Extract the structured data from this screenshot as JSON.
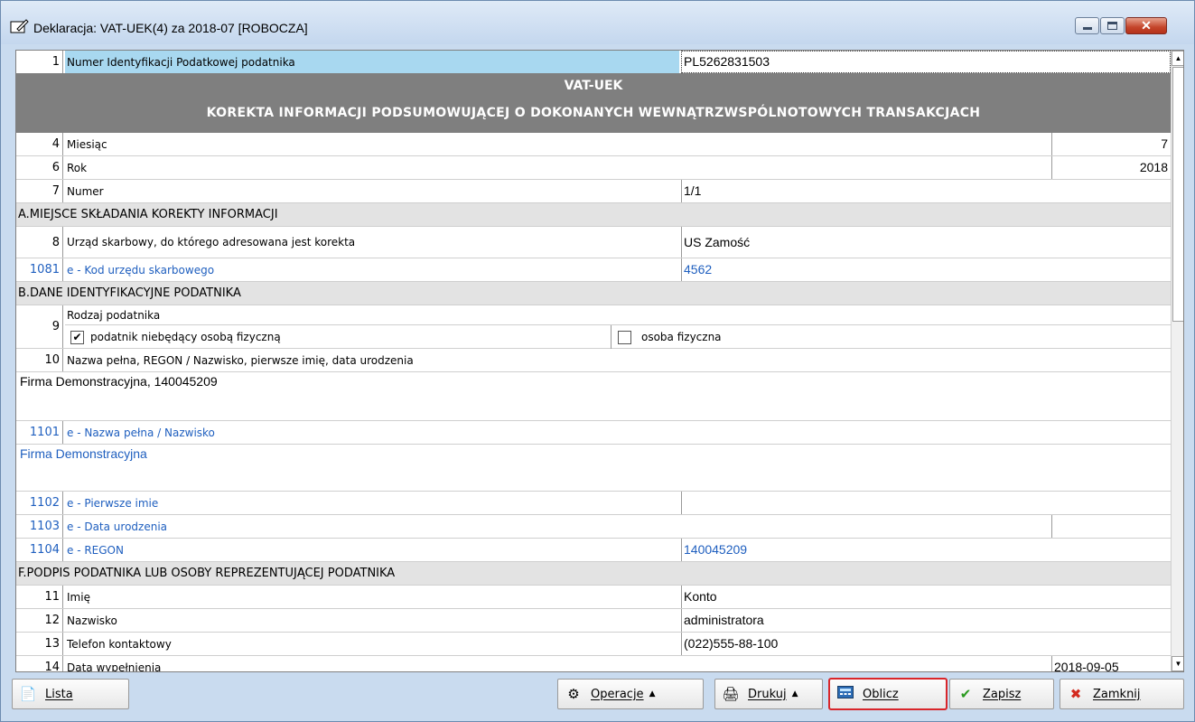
{
  "window": {
    "title": "Deklaracja: VAT-UEK(4) za 2018-07  [ROBOCZA]"
  },
  "form": {
    "row1": {
      "num": "1",
      "label": "Numer Identyfikacji Podatkowej podatnika",
      "value": "PL5262831503"
    },
    "header": {
      "line1": "VAT-UEK",
      "line2": "KOREKTA INFORMACJI PODSUMOWUJĄCEJ O DOKONANYCH WEWNĄTRZWSPÓLNOTOWYCH TRANSAKCJACH"
    },
    "row4": {
      "num": "4",
      "label": "Miesiąc",
      "value": "7"
    },
    "row6": {
      "num": "6",
      "label": "Rok",
      "value": "2018"
    },
    "row7": {
      "num": "7",
      "label": "Numer",
      "value": "1/1"
    },
    "sectionA": "A.MIEJSCE SKŁADANIA KOREKTY INFORMACJI",
    "row8": {
      "num": "8",
      "label": "Urząd skarbowy, do którego adresowana jest korekta",
      "value": "US Zamość"
    },
    "row1081": {
      "num": "1081",
      "label": "e - Kod urzędu skarbowego",
      "value": "4562"
    },
    "sectionB": "B.DANE IDENTYFIKACYJNE PODATNIKA",
    "row9": {
      "num": "9",
      "label": "Rodzaj podatnika",
      "option1": "podatnik niebędący osobą fizyczną",
      "option1_mark": "✔",
      "option2": "osoba fizyczna"
    },
    "row10": {
      "num": "10",
      "label": "Nazwa pełna, REGON / Nazwisko, pierwsze imię, data urodzenia",
      "value": "Firma Demonstracyjna, 140045209"
    },
    "row1101": {
      "num": "1101",
      "label": "e - Nazwa pełna / Nazwisko",
      "value": "Firma Demonstracyjna"
    },
    "row1102": {
      "num": "1102",
      "label": "e - Pierwsze imie",
      "value": ""
    },
    "row1103": {
      "num": "1103",
      "label": "e - Data urodzenia",
      "value": ""
    },
    "row1104": {
      "num": "1104",
      "label": "e - REGON",
      "value": "140045209"
    },
    "sectionF": "F.PODPIS PODATNIKA LUB OSOBY REPREZENTUJĄCEJ PODATNIKA",
    "row11": {
      "num": "11",
      "label": "Imię",
      "value": "Konto"
    },
    "row12": {
      "num": "12",
      "label": "Nazwisko",
      "value": "administratora"
    },
    "row13": {
      "num": "13",
      "label": "Telefon kontaktowy",
      "value": "(022)555-88-100"
    },
    "row14": {
      "num": "14",
      "label": "Data wypełnienia",
      "value": "2018-09-05"
    }
  },
  "toolbar": {
    "lista": "Lista",
    "operacje": "Operacje",
    "drukuj": "Drukuj",
    "oblicz": "Oblicz",
    "zapisz": "Zapisz",
    "zamknij": "Zamknij"
  },
  "colors": {
    "accent_blue": "#1f5fbf",
    "highlight_red": "#d9262b",
    "header_band": "#7f7f7f"
  }
}
